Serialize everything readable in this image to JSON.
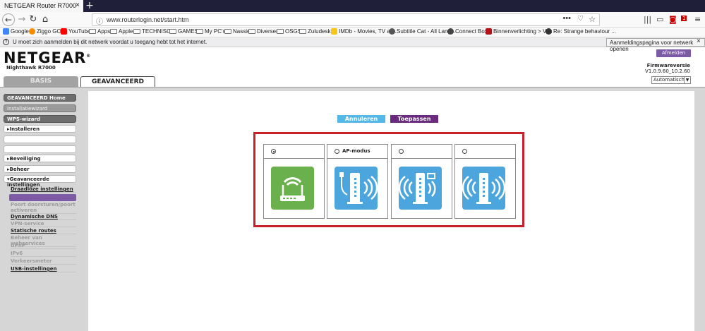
{
  "browser": {
    "tab_title": "NETGEAR Router R7000",
    "tab_close": "×",
    "new_tab": "+",
    "url": "www.routerlogin.net/start.htm",
    "bookmarks": [
      {
        "label": "Google",
        "color": "#4285f4"
      },
      {
        "label": "Ziggo GO",
        "color": "#f48c00"
      },
      {
        "label": "YouTube",
        "color": "#ff0000"
      },
      {
        "label": "Apps",
        "color": "folder"
      },
      {
        "label": "Apple",
        "color": "folder"
      },
      {
        "label": "TECHNISCH",
        "color": "folder"
      },
      {
        "label": "GAMES",
        "color": "folder"
      },
      {
        "label": "My PC's",
        "color": "folder"
      },
      {
        "label": "Nassie",
        "color": "folder"
      },
      {
        "label": "Diversen",
        "color": "folder"
      },
      {
        "label": "OSGS",
        "color": "folder"
      },
      {
        "label": "Zuludesk",
        "color": "folder"
      },
      {
        "label": "IMDb - Movies, TV an...",
        "color": "#f5c518"
      },
      {
        "label": "Subtitle Cat - All Lang...",
        "color": "#555555"
      },
      {
        "label": "Connect Box",
        "color": "#444444"
      },
      {
        "label": "Binnenverlichting > Vi...",
        "color": "#b0141a"
      },
      {
        "label": "Re: Strange behaviour ...",
        "color": "#333333"
      }
    ],
    "notification": "U moet zich aanmelden bij dit netwerk voordat u toegang hebt tot het internet.",
    "notification_button": "Aanmeldingspagina voor netwerk openen",
    "notification_close": "×",
    "badge_count": "1"
  },
  "router": {
    "brand": "NETGEAR",
    "model": "Nighthawk R7000",
    "logout": "Afmelden",
    "firmware_label": "Firmwareversie",
    "firmware_version": "V1.0.9.60_10.2.60",
    "language": "Automatisch",
    "tabs": {
      "basic": "BASIS",
      "advanced": "GEAVANCEERD"
    },
    "sidebar": {
      "home": "GEAVANCEERD Home",
      "wizard": "Installatiewizard",
      "wps": "WPS-wizard",
      "install": "▸Installeren",
      "security": "▸Beveiliging",
      "admin": "▸Beheer",
      "adv_settings": "▾Geavanceerde instellingen",
      "links": [
        {
          "label": "Draadloze instellingen",
          "enabled": true
        },
        {
          "label": "Poort doorsturen/poort activeren",
          "enabled": false
        },
        {
          "label": "Dynamische DNS",
          "enabled": true
        },
        {
          "label": "VPN-service",
          "enabled": false
        },
        {
          "label": "Statische routes",
          "enabled": true
        },
        {
          "label": "Beheer van webservices",
          "enabled": false
        },
        {
          "label": "UPnP",
          "enabled": false
        },
        {
          "label": "IPv6",
          "enabled": false
        },
        {
          "label": "Verkeersmeter",
          "enabled": false
        },
        {
          "label": "USB-instellingen",
          "enabled": true
        }
      ]
    },
    "buttons": {
      "cancel": "Annuleren",
      "apply": "Toepassen"
    },
    "modes": [
      {
        "label": "",
        "selected": true
      },
      {
        "label": "AP-modus",
        "selected": false
      },
      {
        "label": "",
        "selected": false
      },
      {
        "label": "",
        "selected": false
      }
    ]
  }
}
